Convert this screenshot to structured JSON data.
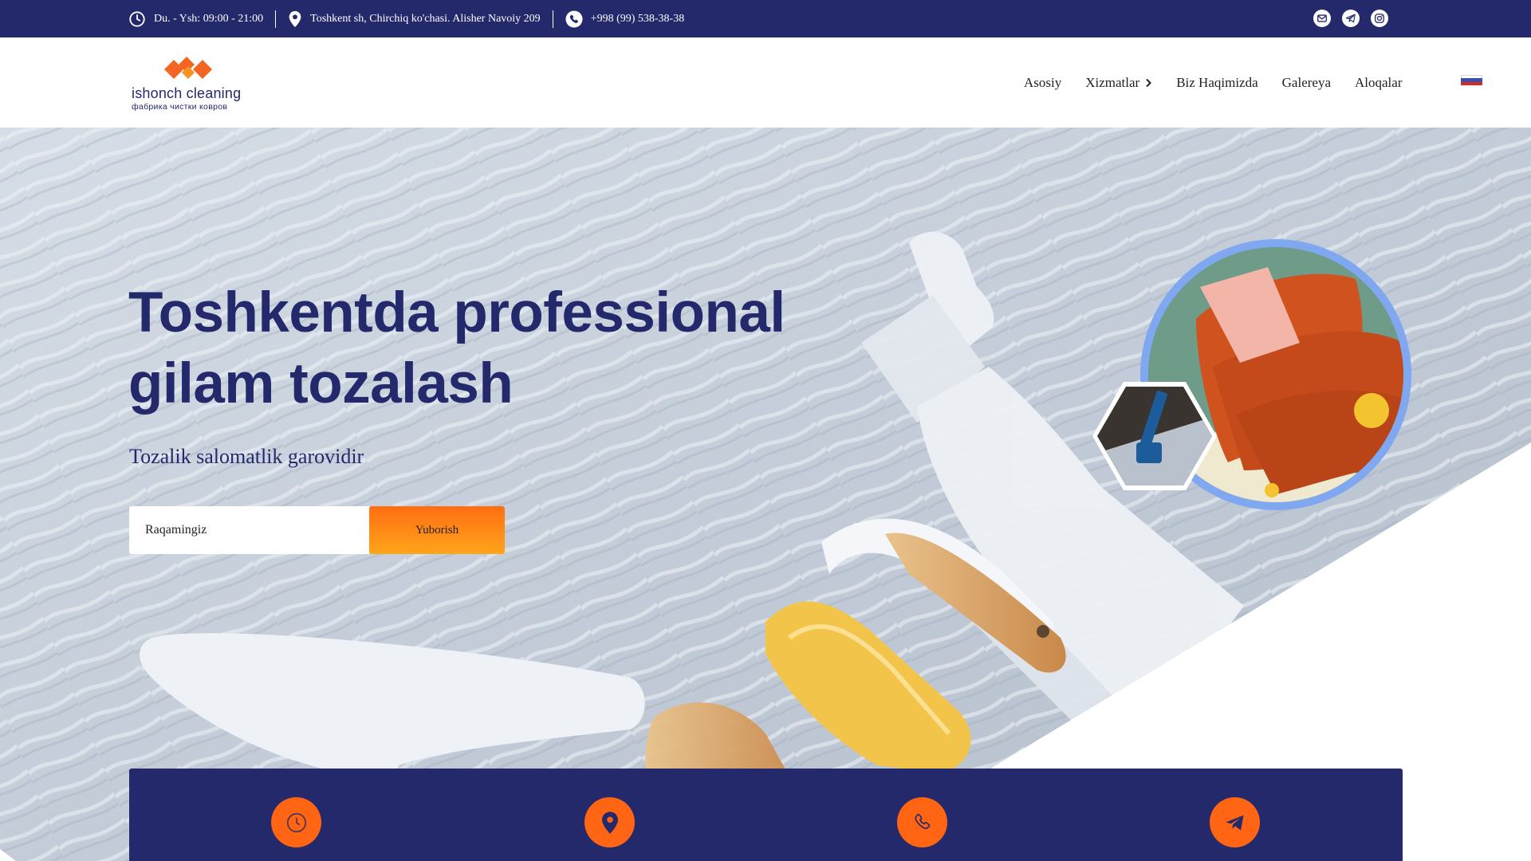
{
  "topbar": {
    "hours": "Du. - Ysh: 09:00 - 21:00",
    "address": "Toshkent sh, Chirchiq ko'chasi. Alisher Navoiy 209",
    "phone": "+998 (99) 538-38-38",
    "socials": [
      "mail-icon",
      "telegram-icon",
      "instagram-icon"
    ]
  },
  "logo": {
    "brand": "ishonch cleaning",
    "tagline": "фабрика чистки ковров"
  },
  "nav": {
    "items": [
      {
        "label": "Asosiy"
      },
      {
        "label": "Xizmatlar",
        "has_submenu": true
      },
      {
        "label": "Biz Haqimizda"
      },
      {
        "label": "Galereya"
      },
      {
        "label": "Aloqalar"
      }
    ],
    "language_flag": "russian-flag-icon"
  },
  "hero": {
    "title": "Toshkentda professional gilam tozalash",
    "subtitle": "Tozalik salomatlik garovidir",
    "form": {
      "placeholder": "Raqamingiz",
      "button_label": "Yuborish"
    }
  },
  "info_band": {
    "icons": [
      "clock-icon",
      "location-icon",
      "phone-icon",
      "telegram-icon"
    ]
  },
  "colors": {
    "primary": "#23296b",
    "accent": "#ff6512",
    "button_gradient_top": "#ff6d12",
    "button_gradient_bottom": "#ffa51a",
    "ring": "#7fa8f0"
  }
}
